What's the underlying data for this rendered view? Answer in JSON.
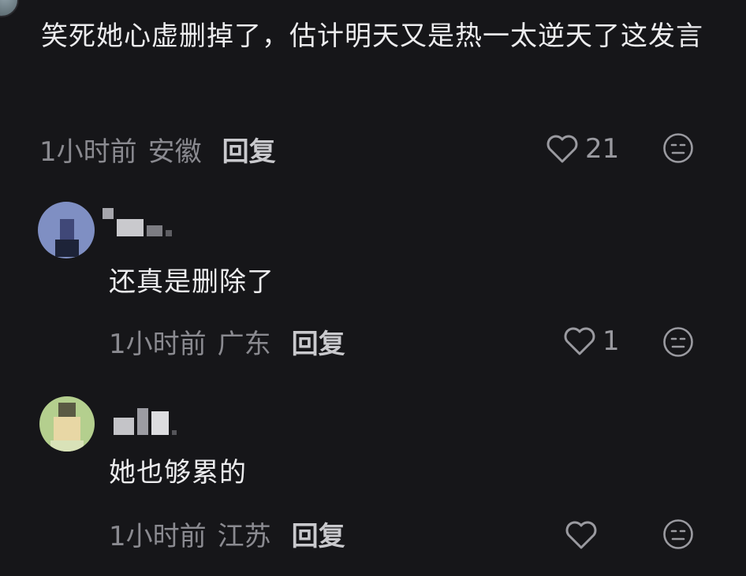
{
  "comments": [
    {
      "text": "笑死她心虚删掉了，估计明天又是热一太逆天了这发言",
      "time": "1小时前",
      "location": "安徽",
      "reply_label": "回复",
      "likes": "21"
    },
    {
      "text": "还真是删除了",
      "time": "1小时前",
      "location": "广东",
      "reply_label": "回复",
      "likes": "1"
    },
    {
      "text": "她也够累的",
      "time": "1小时前",
      "location": "江苏",
      "reply_label": "回复",
      "likes": ""
    }
  ],
  "colors": {
    "background": "#161619",
    "text": "#ececee",
    "muted": "#8a8a90"
  }
}
